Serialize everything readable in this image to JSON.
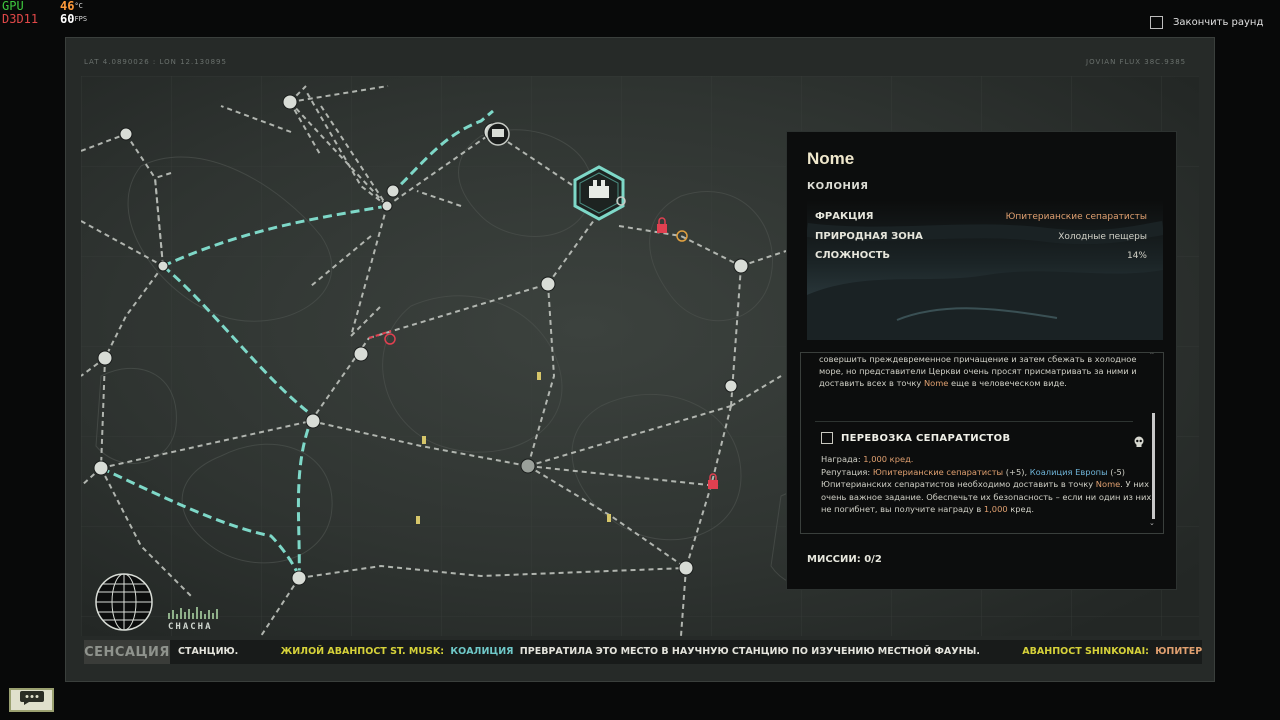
{
  "overlay": {
    "gpu_label": "GPU",
    "gpu_temp": "46",
    "gpu_unit": "°C",
    "api_label": "D3D11",
    "fps": "60",
    "fps_unit": "FPS"
  },
  "end_round_label": "Закончить раунд",
  "map": {
    "coords_left": "LAT 4.0890026 : LON 12.130895",
    "coords_right": "JOVIAN FLUX 38C.9385"
  },
  "panel": {
    "title": "Nome",
    "subtitle": "КОЛОНИЯ",
    "stats": [
      {
        "label": "ФРАКЦИЯ",
        "value": "Юпитерианские сепаратисты"
      },
      {
        "label": "ПРИРОДНАЯ ЗОНА",
        "value": "Холодные пещеры"
      },
      {
        "label": "СЛОЖНОСТЬ",
        "value": "14%"
      }
    ],
    "description_part1": "совершить преждевременное причащение и затем сбежать в холодное море, но представители Церкви очень просят присматривать за ними и доставить всех в точку ",
    "description_location": "Nome",
    "description_part2": " еще в человеческом виде.",
    "mission": {
      "title": "ПЕРЕВОЗКА СЕПАРАТИСТОВ",
      "reward_label": "Награда:",
      "reward_value": "1,000 кред.",
      "rep_label": "Репутация:",
      "rep_faction1": "Юпитерианские сепаратисты",
      "rep_value1": "(+5),",
      "rep_faction2": "Коалиция Европы",
      "rep_value2": "(-5)",
      "body_part1": "Юпитерианских сепаратистов необходимо доставить в точку ",
      "body_location": "Nome",
      "body_part2": ". У них очень важное задание. Обеспечьте их безопасность – если ни один из них не погибнет, вы получите награду в ",
      "body_amount": "1,000",
      "body_part3": " кред."
    },
    "missions_count": "МИССИИ: 0/2"
  },
  "ticker": {
    "badge": "СЕНСАЦИЯ",
    "item1_text": "СТАНЦИЮ.",
    "item2_place": "ЖИЛОЙ АВАНПОСТ ST. MUSK:",
    "item2_faction": "КОАЛИЦИЯ",
    "item2_text": "ПРЕВРАТИЛА ЭТО МЕСТО В НАУЧНУЮ СТАНЦИЮ ПО ИЗУЧЕНИЮ МЕСТНОЙ ФАУНЫ.",
    "item3_place": "АВАНПОСТ SHINKONAI:",
    "item3_faction": "ЮПИТЕРИАНСКИЕ СЕПАРА"
  },
  "signal_text": "СНАСНА",
  "icons": [
    "gpu-overlay",
    "checkbox-icon",
    "skull-icon",
    "lock-icon",
    "globe-icon",
    "signal-icon",
    "chat-icon",
    "station-node-icon",
    "outpost-node-icon",
    "colony-node-icon",
    "beacon-icon"
  ],
  "colors": {
    "route_active": "#7ed8c8",
    "route_path": "#c8ccc6",
    "accent": "#e0a070",
    "danger": "#e04050",
    "link_blue": "#6fb4d8"
  }
}
